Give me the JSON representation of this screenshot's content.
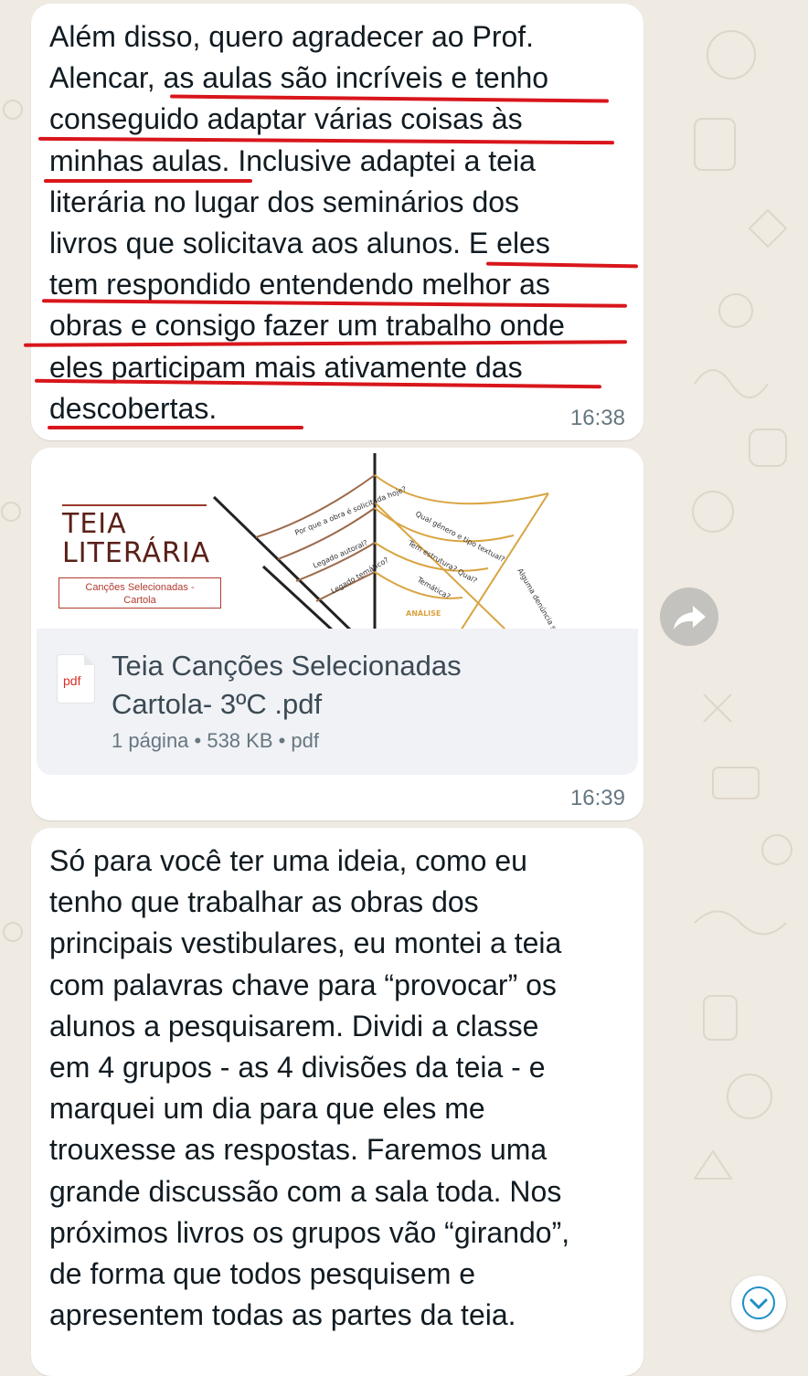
{
  "messages": [
    {
      "text": "Além disso, quero agradecer ao Prof.\nAlencar, as aulas são incríveis e tenho\nconseguido adaptar várias coisas às\nminhas aulas. Inclusive adaptei a teia\nliterária no lugar dos seminários dos\nlivros que solicitava aos alunos. E eles\ntem respondido entendendo melhor as\nobras e consigo fazer um trabalho onde\neles participam mais ativamente das\ndescobertas.",
      "time": "16:38"
    },
    {
      "document": {
        "preview": {
          "logo_line1": "TEIA",
          "logo_line2": "LITERÁRIA",
          "logo_caption": "Canções Selecionadas -\nCartola",
          "web_labels": [
            "Por que a obra é solicitada hoje?",
            "Legado autoral?",
            "Legado temático?",
            "Qual gênero e tipo textual?",
            "Tem estrutura? Qual?",
            "Temática?",
            "Alguma denúncia sociopolítica?",
            "ANÁLISE"
          ]
        },
        "title": "Teia Canções Selecionadas\nCartola-  3ºC .pdf",
        "meta": "1 página • 538 KB • pdf",
        "icon_label": "pdf"
      },
      "time": "16:39"
    },
    {
      "text": "Só para você ter uma ideia, como eu\ntenho que trabalhar as obras dos\nprincipais vestibulares, eu montei a teia\ncom palavras chave para “provocar” os\nalunos a pesquisarem. Dividi a classe\nem 4 grupos - as 4 divisões da teia - e\nmarquei um dia para que eles me\ntrouxesse as respostas. Faremos uma\ngrande discussão com a sala toda. Nos\npróximos livros os grupos vão “girando”,\nde forma que todos pesquisem e\napresentem todas as partes da teia."
    }
  ],
  "icons": {
    "forward": "forward-arrow-icon",
    "scroll_down": "chevron-down-icon",
    "file": "pdf-file-icon"
  },
  "colors": {
    "chat_background": "#efeae2",
    "bubble": "#ffffff",
    "underline": "#d8161b",
    "accent": "#1d8fc7"
  }
}
